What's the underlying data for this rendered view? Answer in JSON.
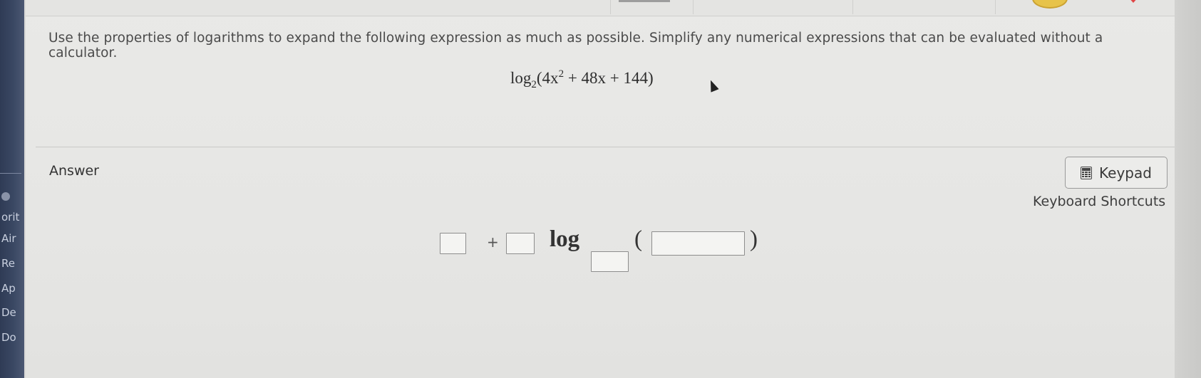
{
  "sidebar": {
    "items": [
      "orit",
      "Air",
      "Re",
      "Ap",
      "De",
      "Do"
    ]
  },
  "question": {
    "prompt": "Use the properties of logarithms to expand the following expression as much as possible. Simplify any numerical expressions that can be evaluated without a calculator.",
    "expression": {
      "func": "log",
      "base": "2",
      "arg_open": "(4x",
      "exp": "2",
      "arg_rest": " + 48x + 144)"
    }
  },
  "answer": {
    "label": "Answer",
    "keypad_label": "Keypad",
    "shortcuts_label": "Keyboard Shortcuts",
    "template": {
      "plus": "+",
      "log": "log",
      "open_paren": "(",
      "close_paren": ")"
    }
  },
  "colors": {
    "panel_bg": "#e7e7e5",
    "text": "#4a4a4a",
    "sidebar_bg": "#34425c"
  }
}
